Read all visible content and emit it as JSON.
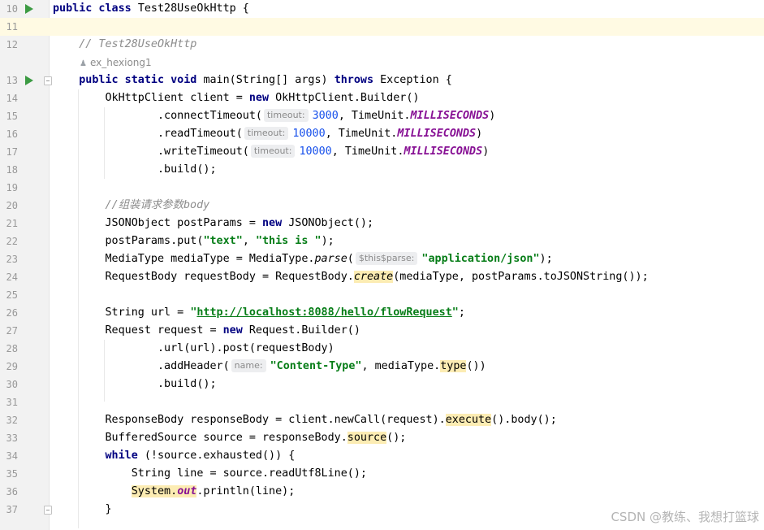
{
  "editor": {
    "lines": [
      {
        "n": "10",
        "run": true,
        "fold": false,
        "current": false,
        "tokens": [
          [
            "kw",
            "public class "
          ],
          [
            "",
            "Test28UseOkHttp {"
          ]
        ]
      },
      {
        "n": "11",
        "run": false,
        "fold": false,
        "current": true,
        "tokens": []
      },
      {
        "n": "12",
        "run": false,
        "fold": false,
        "current": false,
        "tokens": [
          [
            "",
            "    "
          ],
          [
            "cmt",
            "// Test28UseOkHttp"
          ]
        ]
      },
      {
        "n": "",
        "run": false,
        "fold": false,
        "current": false,
        "author": "ex_hexiong1",
        "tokens": []
      },
      {
        "n": "13",
        "run": true,
        "fold": true,
        "current": false,
        "tokens": [
          [
            "",
            "    "
          ],
          [
            "kw",
            "public static void "
          ],
          [
            "",
            "main(String[] args) "
          ],
          [
            "kw",
            "throws "
          ],
          [
            "",
            "Exception {"
          ]
        ]
      },
      {
        "n": "14",
        "run": false,
        "fold": false,
        "current": false,
        "tokens": [
          [
            "",
            "        OkHttpClient client = "
          ],
          [
            "kw",
            "new "
          ],
          [
            "",
            "OkHttpClient.Builder()"
          ]
        ]
      },
      {
        "n": "15",
        "run": false,
        "fold": false,
        "current": false,
        "tokens": [
          [
            "",
            "                .connectTimeout("
          ],
          [
            "hint",
            "timeout:"
          ],
          [
            "num",
            "3000"
          ],
          [
            "",
            ", TimeUnit."
          ],
          [
            "const",
            "MILLISECONDS"
          ],
          [
            "",
            ")"
          ]
        ]
      },
      {
        "n": "16",
        "run": false,
        "fold": false,
        "current": false,
        "tokens": [
          [
            "",
            "                .readTimeout("
          ],
          [
            "hint",
            "timeout:"
          ],
          [
            "num",
            "10000"
          ],
          [
            "",
            ", TimeUnit."
          ],
          [
            "const",
            "MILLISECONDS"
          ],
          [
            "",
            ")"
          ]
        ]
      },
      {
        "n": "17",
        "run": false,
        "fold": false,
        "current": false,
        "tokens": [
          [
            "",
            "                .writeTimeout("
          ],
          [
            "hint",
            "timeout:"
          ],
          [
            "num",
            "10000"
          ],
          [
            "",
            ", TimeUnit."
          ],
          [
            "const",
            "MILLISECONDS"
          ],
          [
            "",
            ")"
          ]
        ]
      },
      {
        "n": "18",
        "run": false,
        "fold": false,
        "current": false,
        "tokens": [
          [
            "",
            "                .build();"
          ]
        ]
      },
      {
        "n": "19",
        "run": false,
        "fold": false,
        "current": false,
        "tokens": []
      },
      {
        "n": "20",
        "run": false,
        "fold": false,
        "current": false,
        "tokens": [
          [
            "",
            "        "
          ],
          [
            "cmt",
            "//组装请求参数body"
          ]
        ]
      },
      {
        "n": "21",
        "run": false,
        "fold": false,
        "current": false,
        "tokens": [
          [
            "",
            "        JSONObject postParams = "
          ],
          [
            "kw",
            "new "
          ],
          [
            "",
            "JSONObject();"
          ]
        ]
      },
      {
        "n": "22",
        "run": false,
        "fold": false,
        "current": false,
        "tokens": [
          [
            "",
            "        postParams.put("
          ],
          [
            "str",
            "\"text\""
          ],
          [
            "",
            ", "
          ],
          [
            "str",
            "\"this is \""
          ],
          [
            "",
            ");"
          ]
        ]
      },
      {
        "n": "23",
        "run": false,
        "fold": false,
        "current": false,
        "tokens": [
          [
            "",
            "        MediaType mediaType = MediaType."
          ],
          [
            "italic",
            "parse"
          ],
          [
            "",
            "("
          ],
          [
            "hint",
            "$this$parse:"
          ],
          [
            "str",
            "\"application/json\""
          ],
          [
            "",
            ");"
          ]
        ]
      },
      {
        "n": "24",
        "run": false,
        "fold": false,
        "current": false,
        "tokens": [
          [
            "",
            "        RequestBody requestBody = RequestBody."
          ],
          [
            "hl italic",
            "create"
          ],
          [
            "",
            "(mediaType, postParams.toJSONString());"
          ]
        ]
      },
      {
        "n": "25",
        "run": false,
        "fold": false,
        "current": false,
        "tokens": []
      },
      {
        "n": "26",
        "run": false,
        "fold": false,
        "current": false,
        "tokens": [
          [
            "",
            "        String url = "
          ],
          [
            "str",
            "\""
          ],
          [
            "url",
            "http://localhost:8088/hello/flowRequest"
          ],
          [
            "str",
            "\""
          ],
          [
            "",
            ";"
          ]
        ]
      },
      {
        "n": "27",
        "run": false,
        "fold": false,
        "current": false,
        "tokens": [
          [
            "",
            "        Request request = "
          ],
          [
            "kw",
            "new "
          ],
          [
            "",
            "Request.Builder()"
          ]
        ]
      },
      {
        "n": "28",
        "run": false,
        "fold": false,
        "current": false,
        "tokens": [
          [
            "",
            "                .url(url).post(requestBody)"
          ]
        ]
      },
      {
        "n": "29",
        "run": false,
        "fold": false,
        "current": false,
        "tokens": [
          [
            "",
            "                .addHeader("
          ],
          [
            "hint",
            "name:"
          ],
          [
            "str",
            "\"Content-Type\""
          ],
          [
            "",
            ", mediaType."
          ],
          [
            "hl",
            "type"
          ],
          [
            "",
            "())"
          ]
        ]
      },
      {
        "n": "30",
        "run": false,
        "fold": false,
        "current": false,
        "tokens": [
          [
            "",
            "                .build();"
          ]
        ]
      },
      {
        "n": "31",
        "run": false,
        "fold": false,
        "current": false,
        "tokens": []
      },
      {
        "n": "32",
        "run": false,
        "fold": false,
        "current": false,
        "tokens": [
          [
            "",
            "        ResponseBody responseBody = client.newCall(request)."
          ],
          [
            "hl",
            "execute"
          ],
          [
            "",
            "().body();"
          ]
        ]
      },
      {
        "n": "33",
        "run": false,
        "fold": false,
        "current": false,
        "tokens": [
          [
            "",
            "        BufferedSource source = responseBody."
          ],
          [
            "hl",
            "source"
          ],
          [
            "",
            "();"
          ]
        ]
      },
      {
        "n": "34",
        "run": false,
        "fold": false,
        "current": false,
        "tokens": [
          [
            "",
            "        "
          ],
          [
            "kw",
            "while "
          ],
          [
            "",
            "(!source.exhausted()) {"
          ]
        ]
      },
      {
        "n": "35",
        "run": false,
        "fold": false,
        "current": false,
        "tokens": [
          [
            "",
            "            String line = source.readUtf8Line();"
          ]
        ]
      },
      {
        "n": "36",
        "run": false,
        "fold": false,
        "current": false,
        "tokens": [
          [
            "",
            "            "
          ],
          [
            "hl",
            "System."
          ],
          [
            "hl const",
            "out"
          ],
          [
            "",
            ".println(line);"
          ]
        ]
      },
      {
        "n": "37",
        "run": false,
        "fold": true,
        "current": false,
        "tokens": [
          [
            "",
            "        }"
          ]
        ]
      }
    ]
  },
  "watermark": "CSDN @教练、我想打篮球"
}
